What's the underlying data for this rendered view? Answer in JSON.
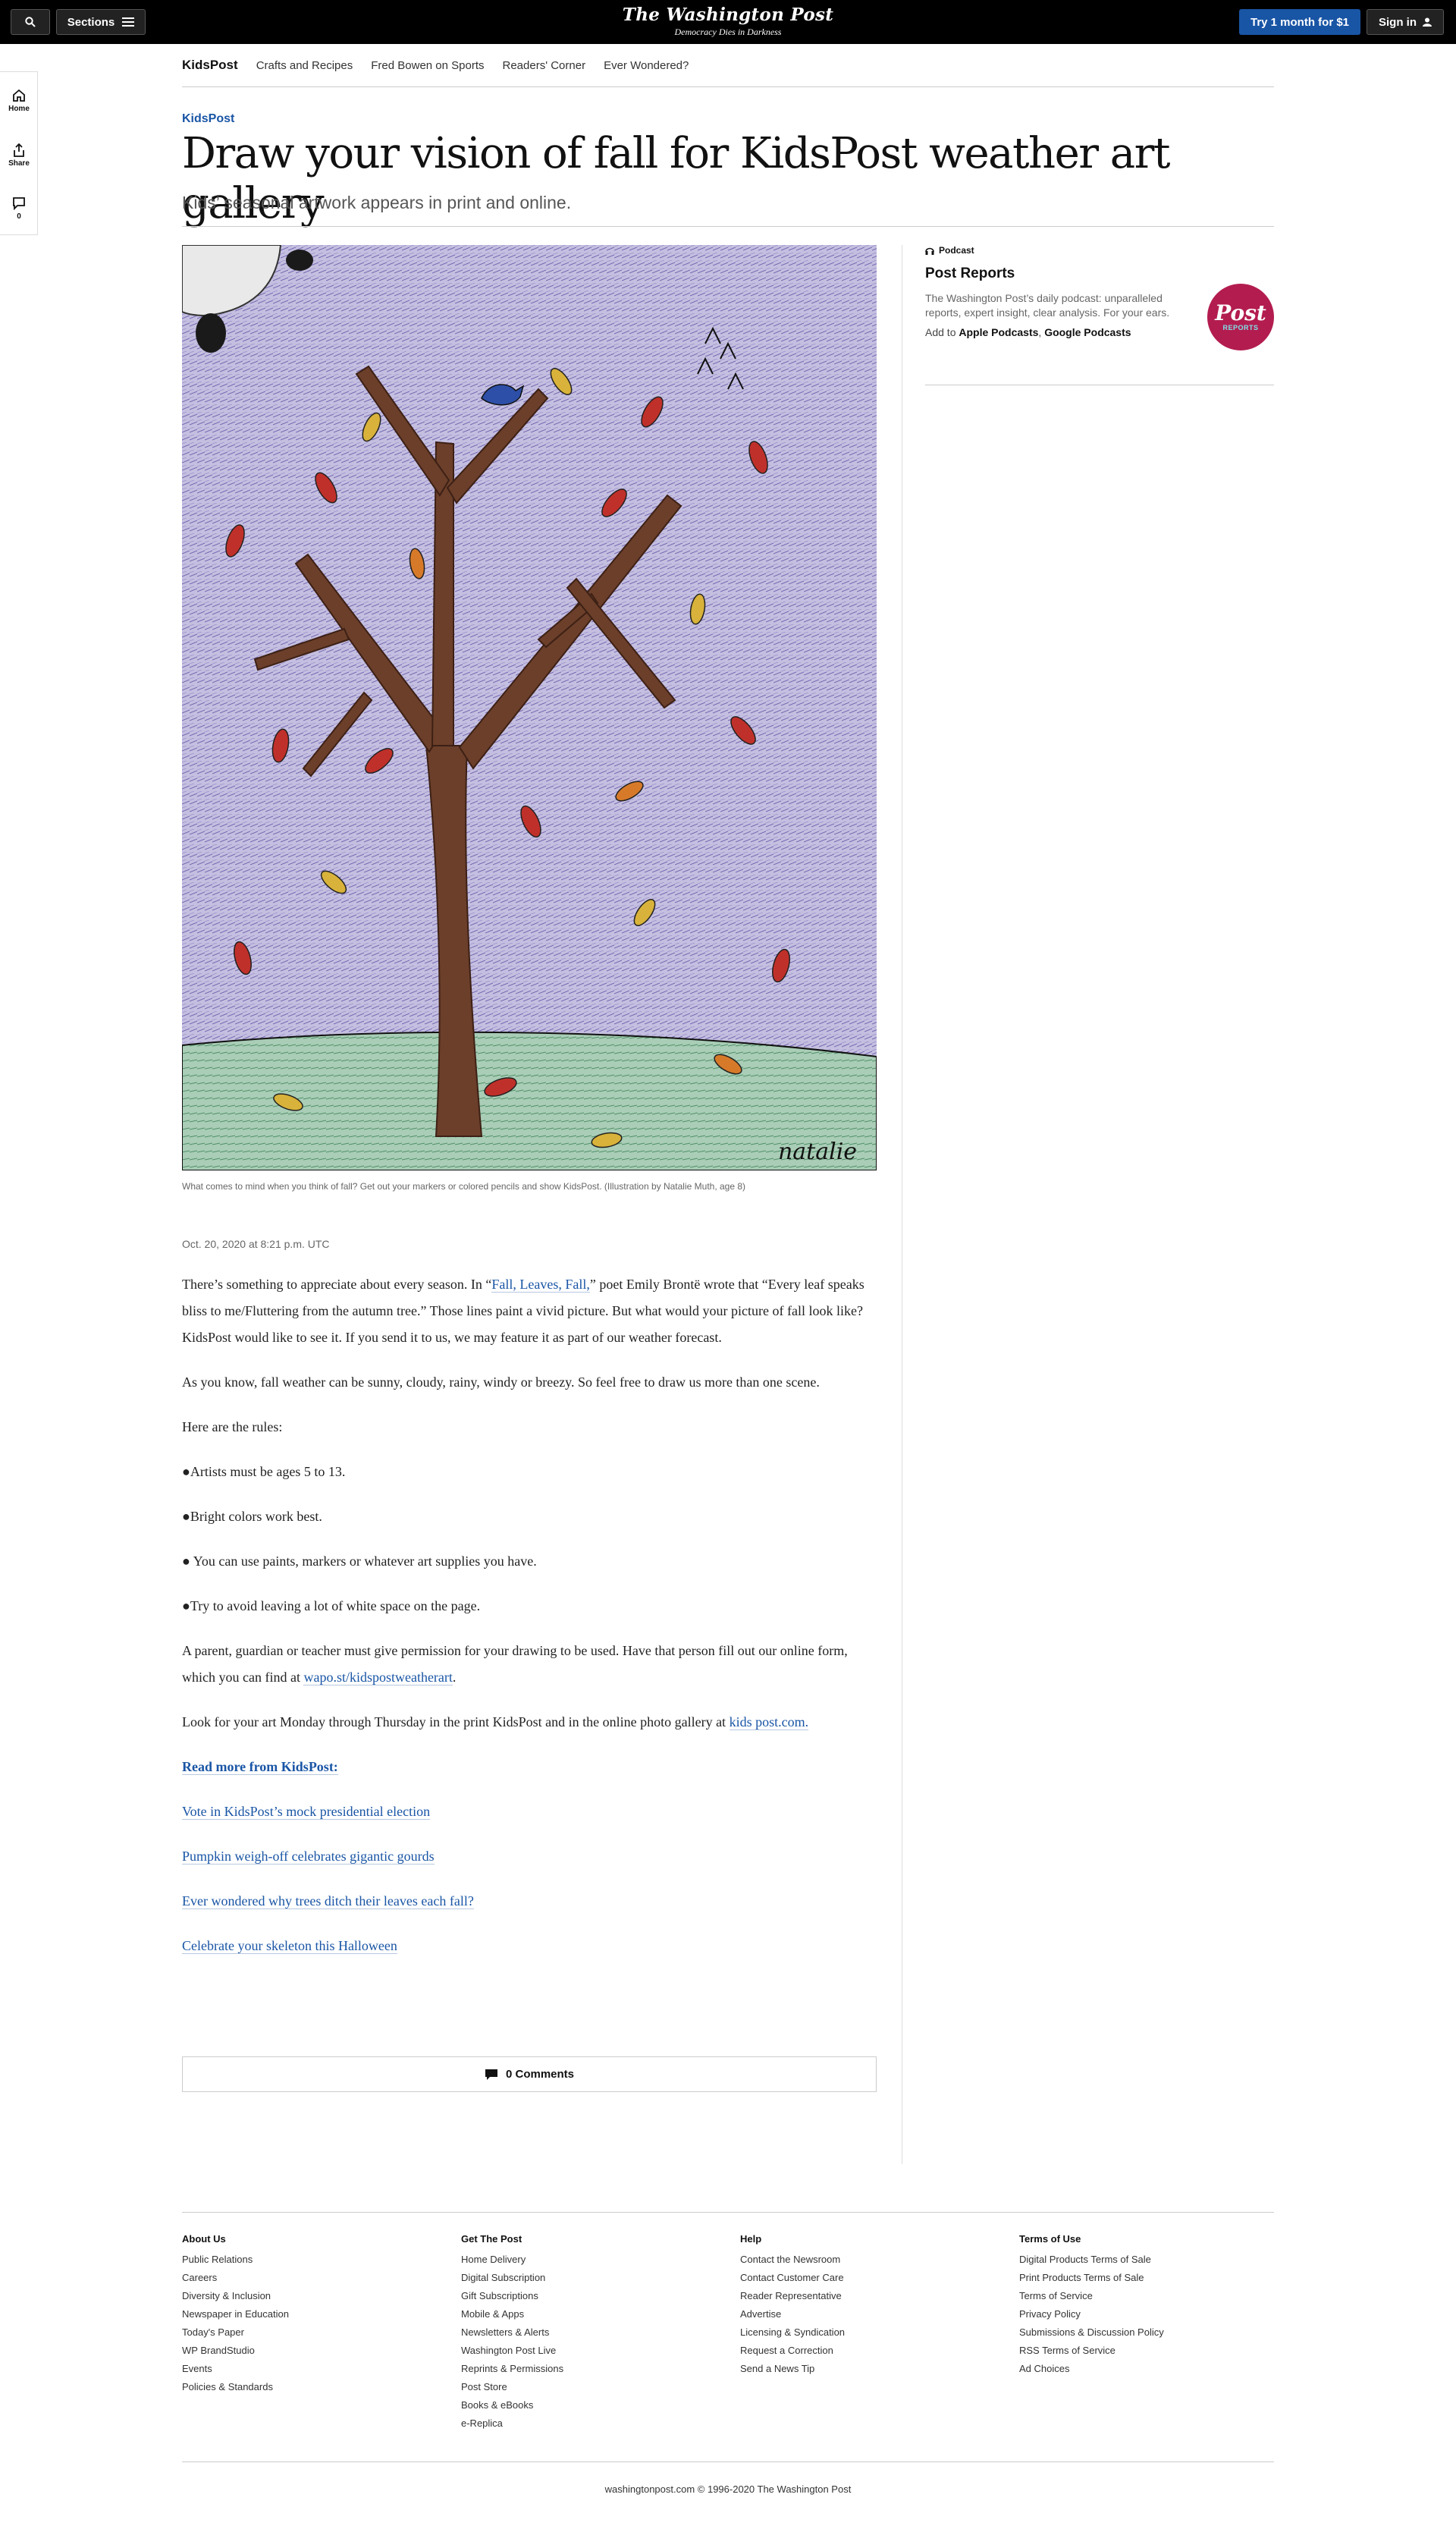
{
  "header": {
    "sections_label": "Sections",
    "logo_name": "The Washington Post",
    "logo_tagline": "Democracy Dies in Darkness",
    "try_label": "Try 1 month for $1",
    "signin_label": "Sign in"
  },
  "subnav": {
    "brand": "KidsPost",
    "links": [
      "Crafts and Recipes",
      "Fred Bowen on Sports",
      "Readers' Corner",
      "Ever Wondered?"
    ]
  },
  "rail": {
    "home": "Home",
    "share": "Share",
    "comments_count": "0"
  },
  "article": {
    "kicker": "KidsPost",
    "headline": "Draw your vision of fall for KidsPost weather art gallery",
    "dek": "Kids’ seasonal artwork appears in print and online.",
    "caption": "What comes to mind when you think of fall? Get out your markers or colored pencils and show KidsPost. (Illustration by Natalie Muth, age 8)",
    "signature": "natalie",
    "date": "Oct. 20, 2020 at 8:21 p.m. UTC",
    "p1_before": "There’s something to appreciate about every season. In “",
    "p1_link": "Fall, Leaves, Fall,",
    "p1_after": "” poet Emily Brontë wrote that “Every leaf speaks bliss to me/Fluttering from the autumn tree.” Those lines paint a vivid picture. But what would your picture of fall look like? KidsPost would like to see it. If you send it to us, we may feature it as part of our weather forecast.",
    "p2": "As you know, fall weather can be sunny, cloudy, rainy, windy or breezy. So feel free to draw us more than one scene.",
    "p3": "Here are the rules:",
    "rule1": "●Artists must be ages 5 to 13.",
    "rule2": "●Bright colors work best.",
    "rule3": "● You can use paints, markers or whatever art supplies you have.",
    "rule4": "●Try to avoid leaving a lot of white space on the page.",
    "p4_before": "A parent, guardian or teacher must give permission for your drawing to be used. Have that person fill out our online form, which you can find at ",
    "p4_link": "wapo.st/kidspostweatherart",
    "p4_after": ".",
    "p5_before": "Look for your art Monday through Thursday in the print KidsPost and in the online photo gallery at ",
    "p5_link": "kids post.com.",
    "readmore": "Read more from KidsPost:",
    "related": [
      "Vote in KidsPost’s mock presidential election",
      "Pumpkin weigh-off celebrates gigantic gourds",
      "Ever wondered why trees ditch their leaves each fall?",
      "Celebrate your skeleton this Halloween"
    ],
    "comments_label": "0 Comments"
  },
  "sidebar": {
    "label": "Podcast",
    "title": "Post Reports",
    "desc": "The Washington Post’s daily podcast: unparalleled reports, expert insight, clear analysis. For your ears.",
    "add_prefix": "Add to ",
    "add_apple": "Apple Podcasts",
    "add_sep": ", ",
    "add_google": "Google Podcasts",
    "logo_line1": "Post",
    "logo_line2": "REPORTS"
  },
  "footer": {
    "columns": [
      {
        "heading": "About Us",
        "links": [
          "Public Relations",
          "Careers",
          "Diversity & Inclusion",
          "Newspaper in Education",
          "Today's Paper",
          "WP BrandStudio",
          "Events",
          "Policies & Standards"
        ]
      },
      {
        "heading": "Get The Post",
        "links": [
          "Home Delivery",
          "Digital Subscription",
          "Gift Subscriptions",
          "Mobile & Apps",
          "Newsletters & Alerts",
          "Washington Post Live",
          "Reprints & Permissions",
          "Post Store",
          "Books & eBooks",
          "e-Replica"
        ]
      },
      {
        "heading": "Help",
        "links": [
          "Contact the Newsroom",
          "Contact Customer Care",
          "Reader Representative",
          "Advertise",
          "Licensing & Syndication",
          "Request a Correction",
          "Send a News Tip"
        ]
      },
      {
        "heading": "Terms of Use",
        "links": [
          "Digital Products Terms of Sale",
          "Print Products Terms of Sale",
          "Terms of Service",
          "Privacy Policy",
          "Submissions & Discussion Policy",
          "RSS Terms of Service",
          "Ad Choices"
        ]
      }
    ],
    "copyright": "washingtonpost.com © 1996-2020 The Washington Post"
  },
  "colors": {
    "accent": "#1955a5",
    "topbar": "#000000",
    "podcast_logo": "#b31c4f"
  }
}
